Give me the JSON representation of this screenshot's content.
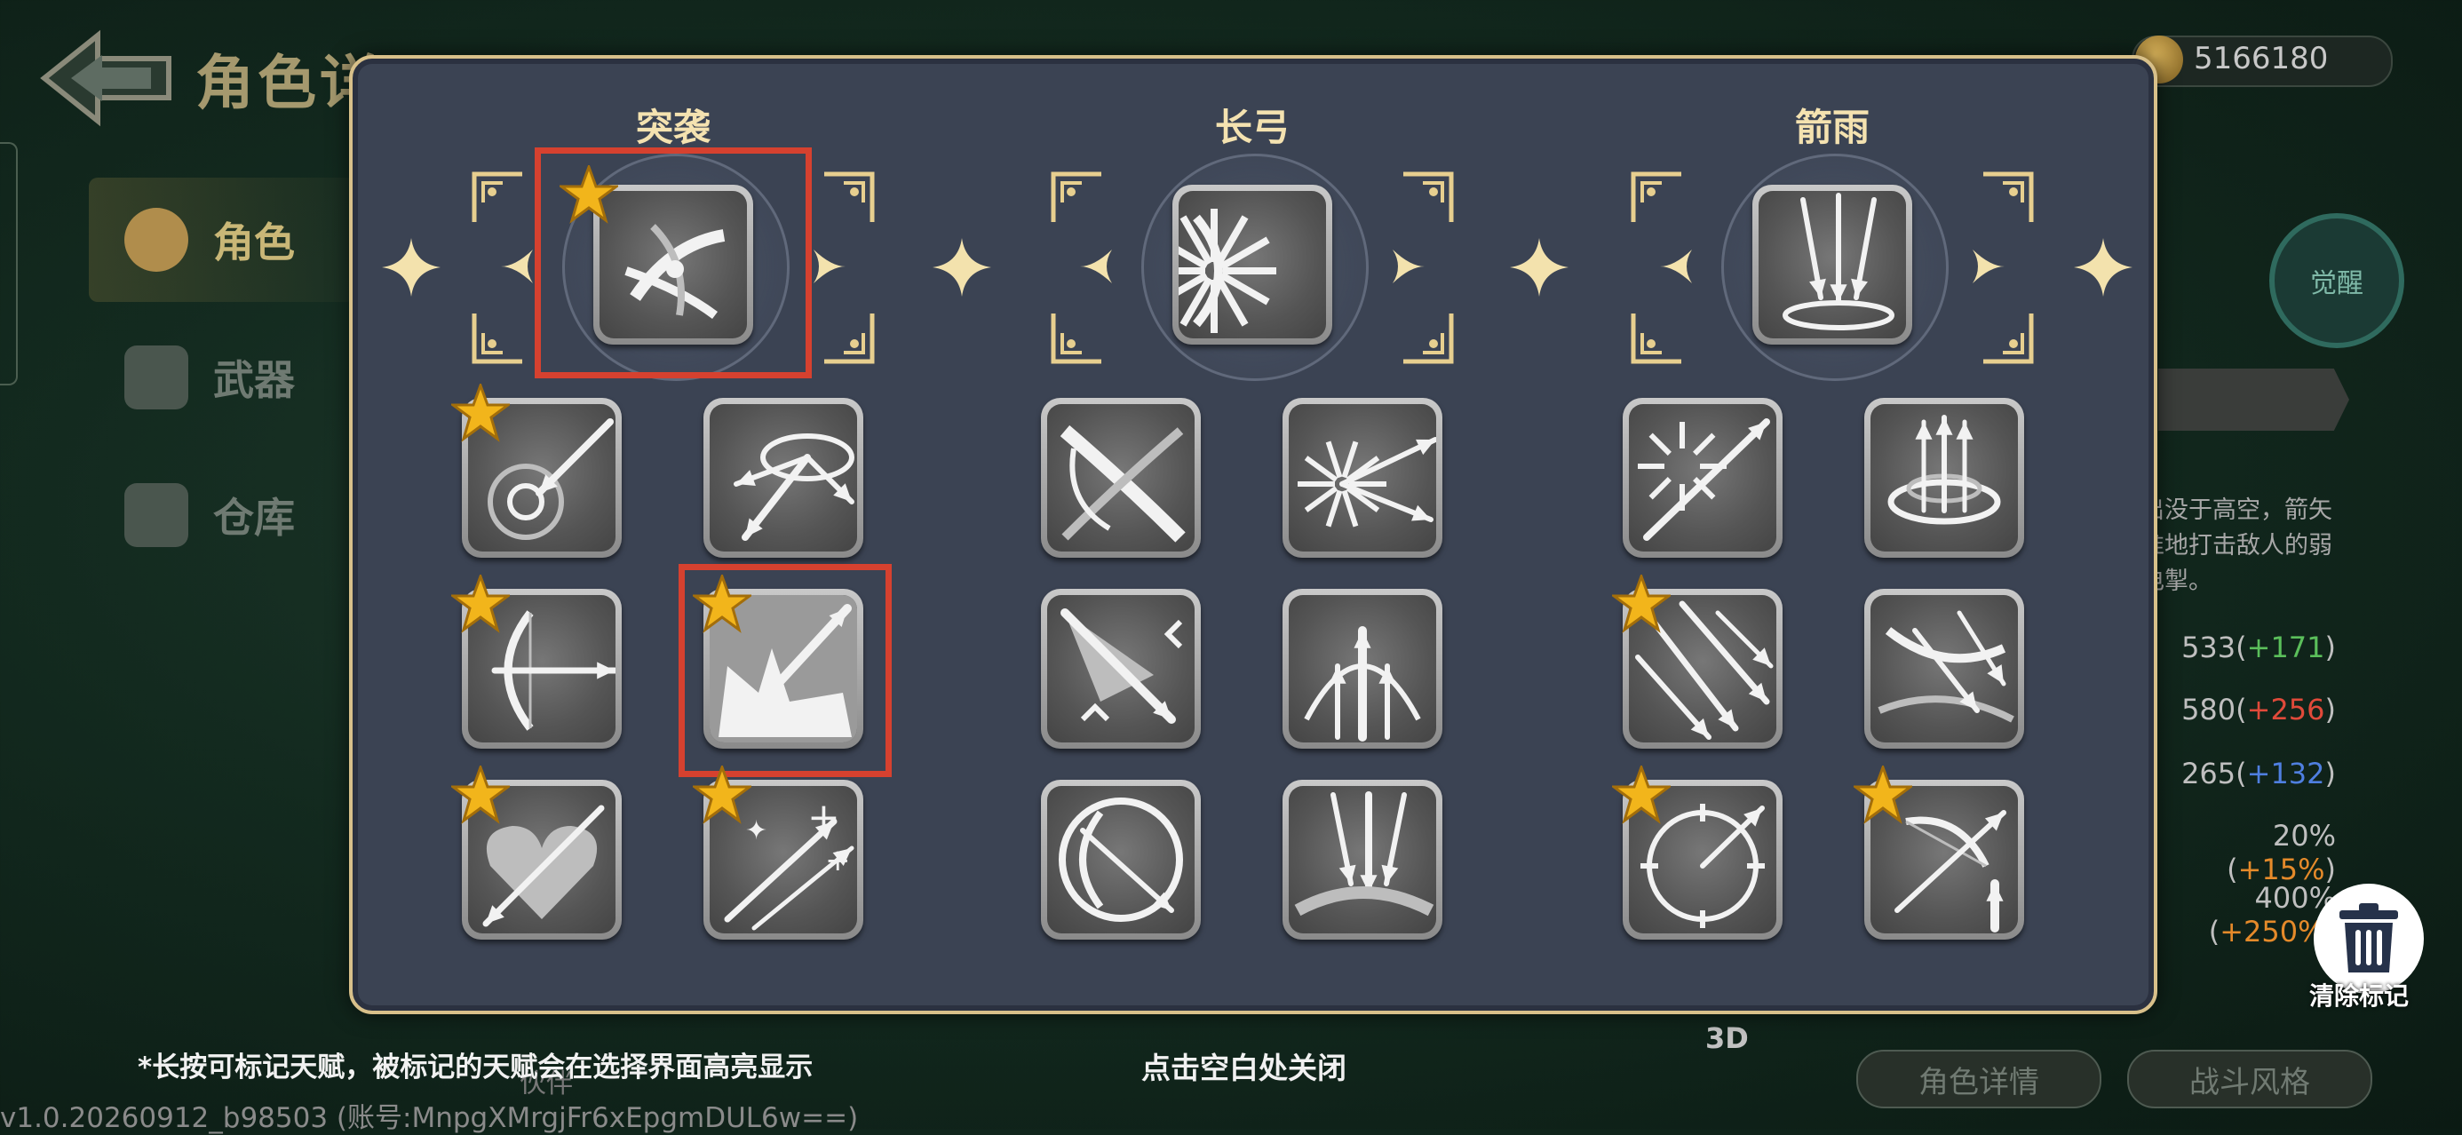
{
  "background": {
    "title": "角色详",
    "currency": "5166180",
    "side_tabs": [
      {
        "label": "角色",
        "active": true
      },
      {
        "label": "武器",
        "active": false
      },
      {
        "label": "仓库",
        "active": false
      }
    ],
    "awaken_label": "觉醒",
    "description": [
      "出没于高空，箭矢",
      "准地打击敌人的弱",
      "电掣。"
    ],
    "stats": [
      {
        "base": "533",
        "delta": "+171",
        "color": "#5bbf5b"
      },
      {
        "base": "580",
        "delta": "+256",
        "color": "#e04a3a"
      },
      {
        "base": "265",
        "delta": "+132",
        "color": "#4f7fe0"
      },
      {
        "base": "20%",
        "delta": "+15%",
        "color": "#e58a2a"
      },
      {
        "base": "400%",
        "delta": "+250%",
        "color": "#e58a2a"
      }
    ],
    "bottom_buttons": [
      "角色详情",
      "战斗风格"
    ],
    "btn_3d": "3D",
    "companion": "伙伴"
  },
  "panel": {
    "columns": [
      {
        "title": "突袭",
        "main_icon": "swirl-strike-icon",
        "main_starred": true,
        "main_highlighted": true,
        "talents": [
          {
            "icon": "target-shot-icon",
            "starred": true,
            "highlighted": false
          },
          {
            "icon": "multi-arrow-burst-icon",
            "starred": false,
            "highlighted": false
          },
          {
            "icon": "bow-shot-icon",
            "starred": true,
            "highlighted": false
          },
          {
            "icon": "piercing-explosion-icon",
            "starred": true,
            "highlighted": true
          },
          {
            "icon": "heart-arrow-icon",
            "starred": true,
            "highlighted": false
          },
          {
            "icon": "sparkle-arrows-icon",
            "starred": true,
            "highlighted": false
          }
        ]
      },
      {
        "title": "长弓",
        "main_icon": "longbow-burst-icon",
        "main_starred": false,
        "main_highlighted": false,
        "talents": [
          {
            "icon": "cross-slash-icon",
            "starred": false,
            "highlighted": false
          },
          {
            "icon": "arrow-spray-icon",
            "starred": false,
            "highlighted": false
          },
          {
            "icon": "power-shot-icon",
            "starred": false,
            "highlighted": false
          },
          {
            "icon": "rising-arrows-icon",
            "starred": false,
            "highlighted": false
          },
          {
            "icon": "bow-ring-icon",
            "starred": false,
            "highlighted": false
          },
          {
            "icon": "falling-arrows-icon",
            "starred": false,
            "highlighted": false
          }
        ]
      },
      {
        "title": "箭雨",
        "main_icon": "arrow-rain-icon",
        "main_starred": false,
        "main_highlighted": false,
        "talents": [
          {
            "icon": "shatter-arrow-icon",
            "starred": false,
            "highlighted": false
          },
          {
            "icon": "arrow-vortex-icon",
            "starred": false,
            "highlighted": false
          },
          {
            "icon": "arrow-barrage-icon",
            "starred": true,
            "highlighted": false
          },
          {
            "icon": "arrow-storm-icon",
            "starred": false,
            "highlighted": false
          },
          {
            "icon": "crosshair-arrow-icon",
            "starred": true,
            "highlighted": false
          },
          {
            "icon": "bow-up-icon",
            "starred": true,
            "highlighted": false
          }
        ]
      }
    ]
  },
  "hint": "*长按可标记天赋，被标记的天赋会在选择界面高亮显示",
  "close_hint": "点击空白处关闭",
  "clear_label": "清除标记",
  "version": "v1.0.20260912_b98503 (账号:MnpgXMrgjFr6xEpgmDUL6w==)",
  "colors": {
    "highlight": "#d6412f",
    "star": "#f2b51b",
    "panel": "#3b4353",
    "frame_gold": "#d8c08a"
  }
}
